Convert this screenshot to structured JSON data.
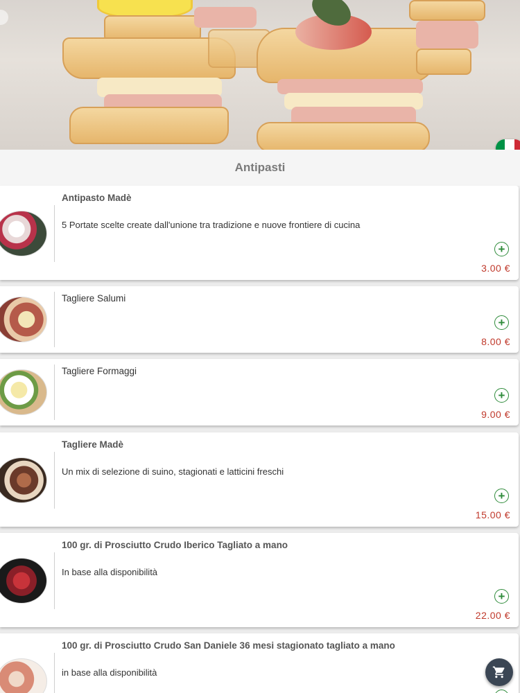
{
  "header": {
    "language_flag": "it-flag",
    "flag_colors": [
      "#009246",
      "#ffffff",
      "#ce2b37"
    ]
  },
  "category": {
    "title": "Antipasti"
  },
  "items": [
    {
      "name": "Antipasto Madè",
      "description": "5 Portate scelte create dall'unione tra tradizione e nuove frontiere di cucina",
      "price": "3.00 €",
      "add_icon": "plus-circle-icon"
    },
    {
      "name": "Tagliere Salumi",
      "description": "",
      "price": "8.00 €",
      "add_icon": "plus-circle-icon"
    },
    {
      "name": "Tagliere Formaggi",
      "description": "",
      "price": "9.00 €",
      "add_icon": "plus-circle-icon"
    },
    {
      "name": "Tagliere Madè",
      "description": "Un mix di selezione di suino, stagionati e latticini freschi",
      "price": "15.00 €",
      "add_icon": "plus-circle-icon"
    },
    {
      "name": "100 gr. di Prosciutto Crudo Iberico Tagliato a mano",
      "description": "In base alla disponibilità",
      "price": "22.00 €",
      "add_icon": "plus-circle-icon"
    },
    {
      "name": "100 gr. di Prosciutto Crudo San Daniele 36 mesi stagionato tagliato a mano",
      "description": "in base alla disponibilità",
      "price": "",
      "add_icon": "plus-circle-icon"
    }
  ],
  "cart": {
    "icon": "cart-icon"
  },
  "colors": {
    "price": "#c0392b",
    "add": "#2e8b3a",
    "fab": "#3b4654"
  }
}
